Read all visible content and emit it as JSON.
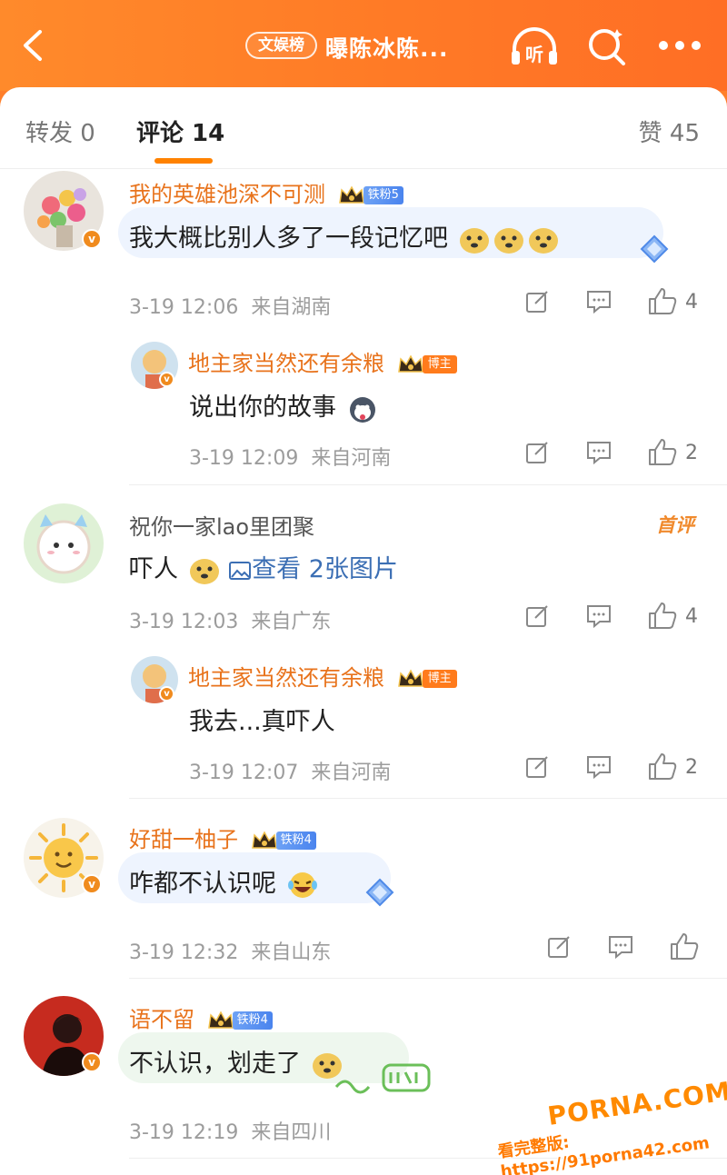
{
  "header": {
    "badge": "文娱榜",
    "title": "曝陈冰陈...",
    "listen_label": "听"
  },
  "tabs": {
    "repost": "转发 0",
    "comment": "评论 14",
    "like": "赞 45"
  },
  "comments": [
    {
      "user": "我的英雄池深不可测",
      "badge": "铁粉5",
      "text": "我大概比别人多了一段记忆吧",
      "time": "3-19 12:06",
      "location": "来自湖南",
      "likes": "4",
      "reply": {
        "user": "地主家当然还有余粮",
        "badge": "博主",
        "text": "说出你的故事",
        "time": "3-19 12:09",
        "location": "来自河南",
        "likes": "2"
      }
    },
    {
      "user": "祝你一家lao里团聚",
      "tag": "首评",
      "text": "吓人",
      "image_link": "查看 2张图片",
      "time": "3-19 12:03",
      "location": "来自广东",
      "likes": "4",
      "reply": {
        "user": "地主家当然还有余粮",
        "badge": "博主",
        "text": "我去...真吓人",
        "time": "3-19 12:07",
        "location": "来自河南",
        "likes": "2"
      }
    },
    {
      "user": "好甜一柚子",
      "badge": "铁粉4",
      "text": "咋都不认识呢",
      "time": "3-19 12:32",
      "location": "来自山东"
    },
    {
      "user": "语不留",
      "badge": "铁粉4",
      "text": "不认识，划走了",
      "time": "3-19 12:19",
      "location": "来自四川"
    }
  ],
  "watermark": {
    "main": "PORNA.COM",
    "sub": "看完整版: https://91porna42.com"
  },
  "colors": {
    "accent": "#ff8200",
    "username": "#e8731c",
    "link": "#3c6fb4"
  }
}
